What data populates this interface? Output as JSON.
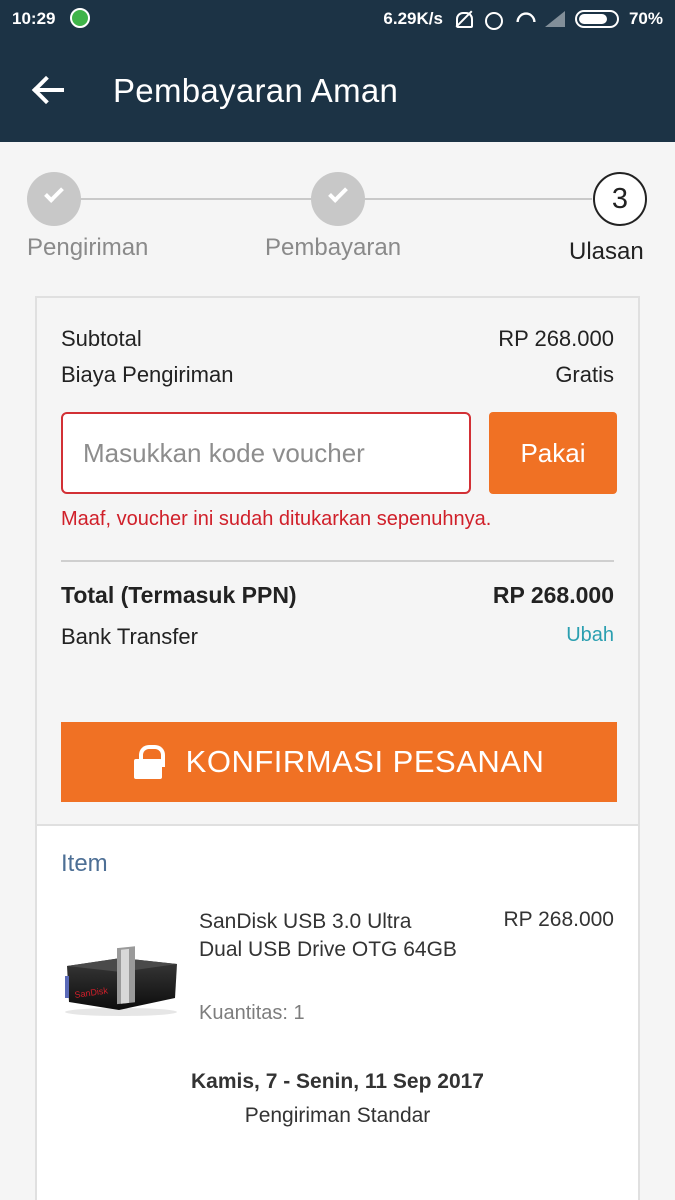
{
  "status_bar": {
    "time": "10:29",
    "speed": "6.29K/s",
    "battery": "70%",
    "battery_level": 0.7
  },
  "app_bar": {
    "title": "Pembayaran Aman"
  },
  "stepper": {
    "steps": [
      {
        "label": "Pengiriman",
        "state": "done"
      },
      {
        "label": "Pembayaran",
        "state": "done"
      },
      {
        "label": "Ulasan",
        "state": "active",
        "number": "3"
      }
    ]
  },
  "summary": {
    "subtotal_label": "Subtotal",
    "subtotal_value": "RP 268.000",
    "shipping_label": "Biaya Pengiriman",
    "shipping_value": "Gratis",
    "voucher_placeholder": "Masukkan kode voucher",
    "voucher_value": "",
    "apply_label": "Pakai",
    "voucher_error": "Maaf, voucher ini sudah ditukarkan sepenuhnya.",
    "total_label": "Total (Termasuk PPN)",
    "total_value": "RP 268.000",
    "payment_method": "Bank Transfer",
    "change_label": "Ubah",
    "confirm_label": "KONFIRMASI PESANAN"
  },
  "items": {
    "title": "Item",
    "product": {
      "name": "SanDisk USB 3.0 Ultra Dual USB Drive OTG 64GB",
      "price": "RP 268.000",
      "quantity": "Kuantitas: 1",
      "brand_text": "SanDisk"
    },
    "delivery_date": "Kamis, 7 - Senin, 11 Sep 2017",
    "delivery_method": "Pengiriman Standar"
  },
  "colors": {
    "header": "#1c3345",
    "accent": "#f07124",
    "error": "#d0202a",
    "link": "#2b9fb0",
    "item_title": "#4d6f95"
  }
}
